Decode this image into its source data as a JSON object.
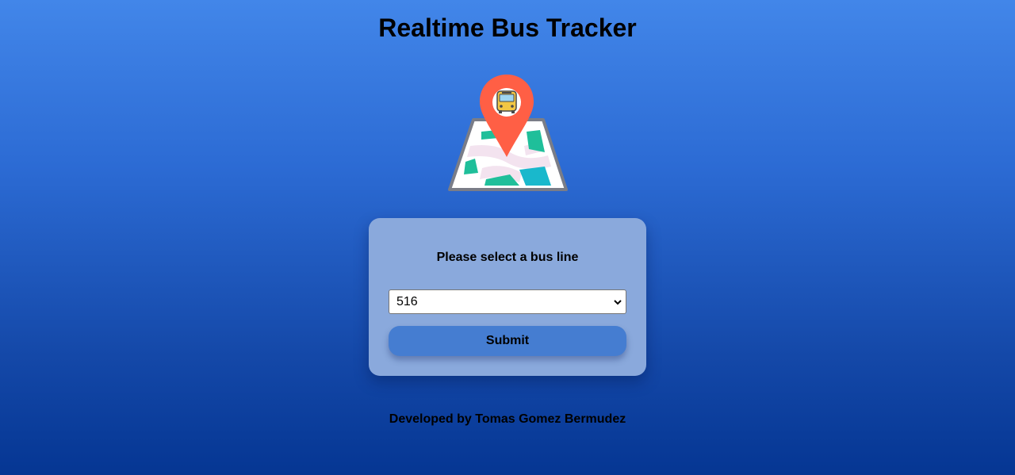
{
  "header": {
    "title": "Realtime Bus Tracker"
  },
  "logo": {
    "icon": "map-pin-bus-icon"
  },
  "form": {
    "prompt": "Please select a bus line",
    "selected_line": "516",
    "submit_label": "Submit"
  },
  "footer": {
    "credit": "Developed by Tomas Gomez Bermudez"
  },
  "colors": {
    "pin": "#ff5f45",
    "card": "#8aa9dc",
    "button": "#457dd1"
  }
}
